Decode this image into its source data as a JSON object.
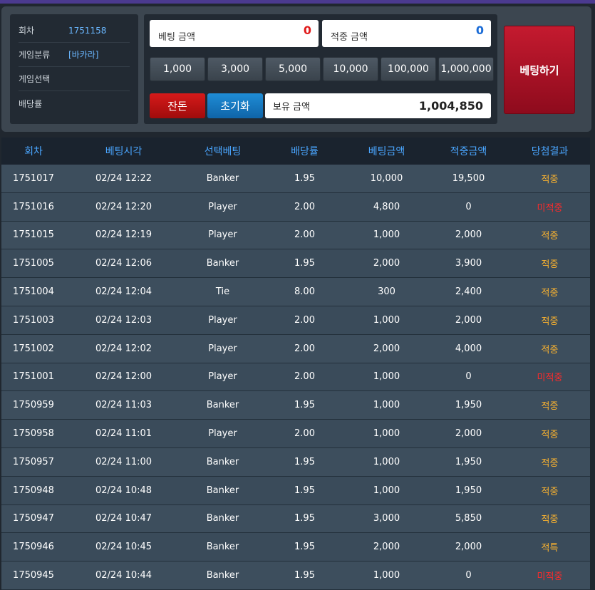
{
  "info": {
    "round_label": "회차",
    "round_value": "1751158",
    "category_label": "게임분류",
    "category_value": "[바카라]",
    "selection_label": "게임선택",
    "selection_value": "",
    "odds_label": "배당률",
    "odds_value": ""
  },
  "bet": {
    "bet_amount_label": "베팅 금액",
    "bet_amount_value": "0",
    "win_amount_label": "적중 금액",
    "win_amount_value": "0",
    "chips": [
      "1,000",
      "3,000",
      "5,000",
      "10,000",
      "100,000",
      "1,000,000"
    ],
    "balance_button": "잔돈",
    "reset_button": "초기화",
    "holding_label": "보유 금액",
    "holding_value": "1,004,850",
    "place_bet_button": "베팅하기"
  },
  "colors": {
    "bet_amount": "#e01b1b",
    "win_amount": "#1a6bd6"
  },
  "table": {
    "headers": [
      "회차",
      "베팅시각",
      "선택베팅",
      "배당률",
      "베팅금액",
      "적중금액",
      "당첨결과"
    ],
    "rows": [
      {
        "round": "1751017",
        "time": "02/24 12:22",
        "pick": "Banker",
        "odds": "1.95",
        "bet": "10,000",
        "win": "19,500",
        "result": "적중",
        "status": "win"
      },
      {
        "round": "1751016",
        "time": "02/24 12:20",
        "pick": "Player",
        "odds": "2.00",
        "bet": "4,800",
        "win": "0",
        "result": "미적중",
        "status": "lose"
      },
      {
        "round": "1751015",
        "time": "02/24 12:19",
        "pick": "Player",
        "odds": "2.00",
        "bet": "1,000",
        "win": "2,000",
        "result": "적중",
        "status": "win"
      },
      {
        "round": "1751005",
        "time": "02/24 12:06",
        "pick": "Banker",
        "odds": "1.95",
        "bet": "2,000",
        "win": "3,900",
        "result": "적중",
        "status": "win"
      },
      {
        "round": "1751004",
        "time": "02/24 12:04",
        "pick": "Tie",
        "odds": "8.00",
        "bet": "300",
        "win": "2,400",
        "result": "적중",
        "status": "win"
      },
      {
        "round": "1751003",
        "time": "02/24 12:03",
        "pick": "Player",
        "odds": "2.00",
        "bet": "1,000",
        "win": "2,000",
        "result": "적중",
        "status": "win"
      },
      {
        "round": "1751002",
        "time": "02/24 12:02",
        "pick": "Player",
        "odds": "2.00",
        "bet": "2,000",
        "win": "4,000",
        "result": "적중",
        "status": "win"
      },
      {
        "round": "1751001",
        "time": "02/24 12:00",
        "pick": "Player",
        "odds": "2.00",
        "bet": "1,000",
        "win": "0",
        "result": "미적중",
        "status": "lose"
      },
      {
        "round": "1750959",
        "time": "02/24 11:03",
        "pick": "Banker",
        "odds": "1.95",
        "bet": "1,000",
        "win": "1,950",
        "result": "적중",
        "status": "win"
      },
      {
        "round": "1750958",
        "time": "02/24 11:01",
        "pick": "Player",
        "odds": "2.00",
        "bet": "1,000",
        "win": "2,000",
        "result": "적중",
        "status": "win"
      },
      {
        "round": "1750957",
        "time": "02/24 11:00",
        "pick": "Banker",
        "odds": "1.95",
        "bet": "1,000",
        "win": "1,950",
        "result": "적중",
        "status": "win"
      },
      {
        "round": "1750948",
        "time": "02/24 10:48",
        "pick": "Banker",
        "odds": "1.95",
        "bet": "1,000",
        "win": "1,950",
        "result": "적중",
        "status": "win"
      },
      {
        "round": "1750947",
        "time": "02/24 10:47",
        "pick": "Banker",
        "odds": "1.95",
        "bet": "3,000",
        "win": "5,850",
        "result": "적중",
        "status": "win"
      },
      {
        "round": "1750946",
        "time": "02/24 10:45",
        "pick": "Banker",
        "odds": "1.95",
        "bet": "2,000",
        "win": "2,000",
        "result": "적특",
        "status": "win"
      },
      {
        "round": "1750945",
        "time": "02/24 10:44",
        "pick": "Banker",
        "odds": "1.95",
        "bet": "1,000",
        "win": "0",
        "result": "미적중",
        "status": "lose"
      }
    ]
  }
}
